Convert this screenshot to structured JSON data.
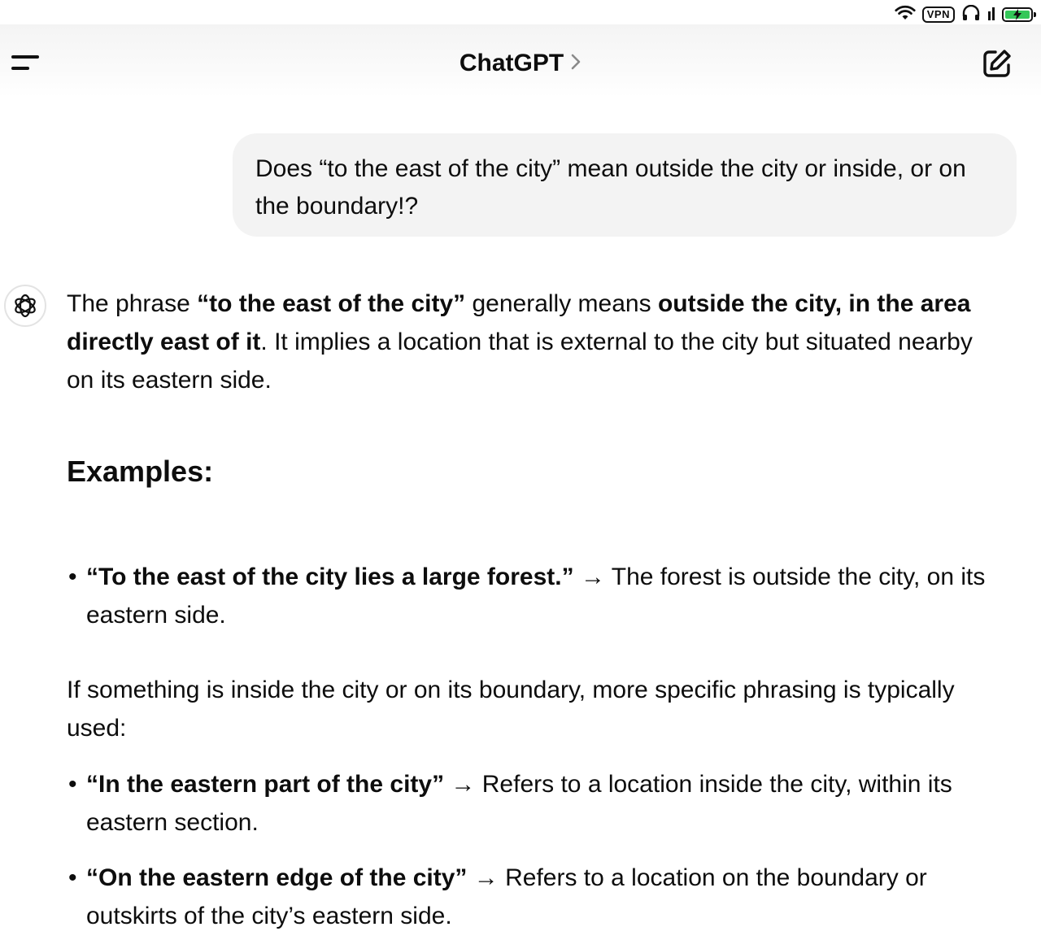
{
  "status_bar": {
    "vpn_label": "VPN",
    "icons": [
      "wifi-icon",
      "vpn-icon",
      "headphones-icon",
      "signal-icon",
      "battery-charging-icon"
    ]
  },
  "header": {
    "title": "ChatGPT",
    "title_chevron": "›",
    "menu_icon": "sidebar-menu-icon",
    "compose_icon": "new-chat-icon"
  },
  "user_message": {
    "text": " Does “to the east of the city” mean outside the city or inside, or on the boundary!?"
  },
  "assistant_message": {
    "intro": {
      "t1": "The phrase ",
      "b1": "“to the east of the city”",
      "t2": " generally means ",
      "b2": "outside the city, in the area directly east of it",
      "t3": ". It implies a location that is external to the city but situated nearby on its eastern side."
    },
    "examples_heading": "Examples:",
    "example_bullet": {
      "bold": "“To the east of the city lies a large forest.”",
      "rest": " → The forest is outside the city, on its eastern side."
    },
    "followup": "If something is inside the city or on its boundary, more specific phrasing is typically used:",
    "bullets": [
      {
        "bold": "“In the eastern part of the city”",
        "rest": " → Refers to a location inside the city, within its eastern section."
      },
      {
        "bold": "“On the eastern edge of the city”",
        "rest": " → Refers to a location on the boundary or outskirts of the city’s eastern side."
      }
    ],
    "bullet_char": "•"
  },
  "colors": {
    "text": "#0d0d0d",
    "user_bubble": "#f3f3f3",
    "battery": "#34c759"
  }
}
